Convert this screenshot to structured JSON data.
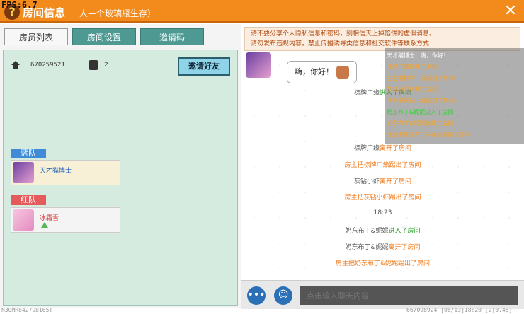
{
  "fps": "FPS:6.7",
  "header": {
    "title": "房间信息",
    "subtitle": "人—个玻璃瓶生存）",
    "help_icon": "question-icon",
    "close_icon": "close-icon"
  },
  "tabs": [
    {
      "label": "房员列表",
      "active": true
    },
    {
      "label": "房间设置",
      "active": false
    },
    {
      "label": "邀请码",
      "active": false
    }
  ],
  "room": {
    "id": "670259521",
    "player_count": "2",
    "invite_label": "邀请好友"
  },
  "teams": {
    "blue": {
      "label": "蓝队",
      "members": [
        {
          "name": "天才猫博士"
        }
      ]
    },
    "red": {
      "label": "红队",
      "members": [
        {
          "name": "冰霜雪"
        }
      ]
    }
  },
  "notice": {
    "line1": "请不要分享个人隐私信息和密码，别相信天上掉馅饼的虚假消息。",
    "line2": "请勿发布违规内容，禁止传播诱导类信息和社交软件等联系方式"
  },
  "chat": {
    "greeting": "嗨，你好！",
    "events": [
      {
        "name": "棕牌广缘",
        "action": "进入了房间",
        "kind": "green"
      },
      {
        "name": "棕牌广缘",
        "action": "离开了房间",
        "kind": "orange"
      },
      {
        "name": "房主把棕牌广缘",
        "action": "踢出了房间",
        "kind": "orange"
      },
      {
        "name": "灰钻小虾",
        "action": "离开了房间",
        "kind": "orange"
      },
      {
        "name": "房主把灰钻小虾",
        "action": "踢出了房间",
        "kind": "orange"
      },
      {
        "name": "18:23",
        "action": "",
        "kind": "time"
      },
      {
        "name": "奶东布丁&妮妮",
        "action": "进入了房间",
        "kind": "green"
      },
      {
        "name": "奶东布丁&妮妮",
        "action": "离开了房间",
        "kind": "orange"
      },
      {
        "name": "房主把奶东布丁&妮妮",
        "action": "踢出了房间",
        "kind": "orange"
      }
    ]
  },
  "overlay_lines": [
    {
      "text": "天才猫博士：嗨，你好！",
      "kind": "white"
    },
    {
      "text": "棕牌广缘离开了房间",
      "kind": "orange"
    },
    {
      "text": "房主把棕牌广缘踢出了房间",
      "kind": "orange"
    },
    {
      "text": "灰钻小虾离开了房间",
      "kind": "orange"
    },
    {
      "text": "房主把灰钻小虾踢出了房间",
      "kind": "orange"
    },
    {
      "text": "奶东布丁&妮妮进入了房间",
      "kind": "green"
    },
    {
      "text": "奶东布丁&妮妮离开了房间",
      "kind": "orange"
    },
    {
      "text": "房主把奶东布丁&妮妮踢出了房间",
      "kind": "orange"
    }
  ],
  "input": {
    "placeholder": "点击输入聊天内容"
  },
  "footer": {
    "left": "N30MH842798165T",
    "right": "667098924 [06/13]18:20 [2|0.46]"
  }
}
